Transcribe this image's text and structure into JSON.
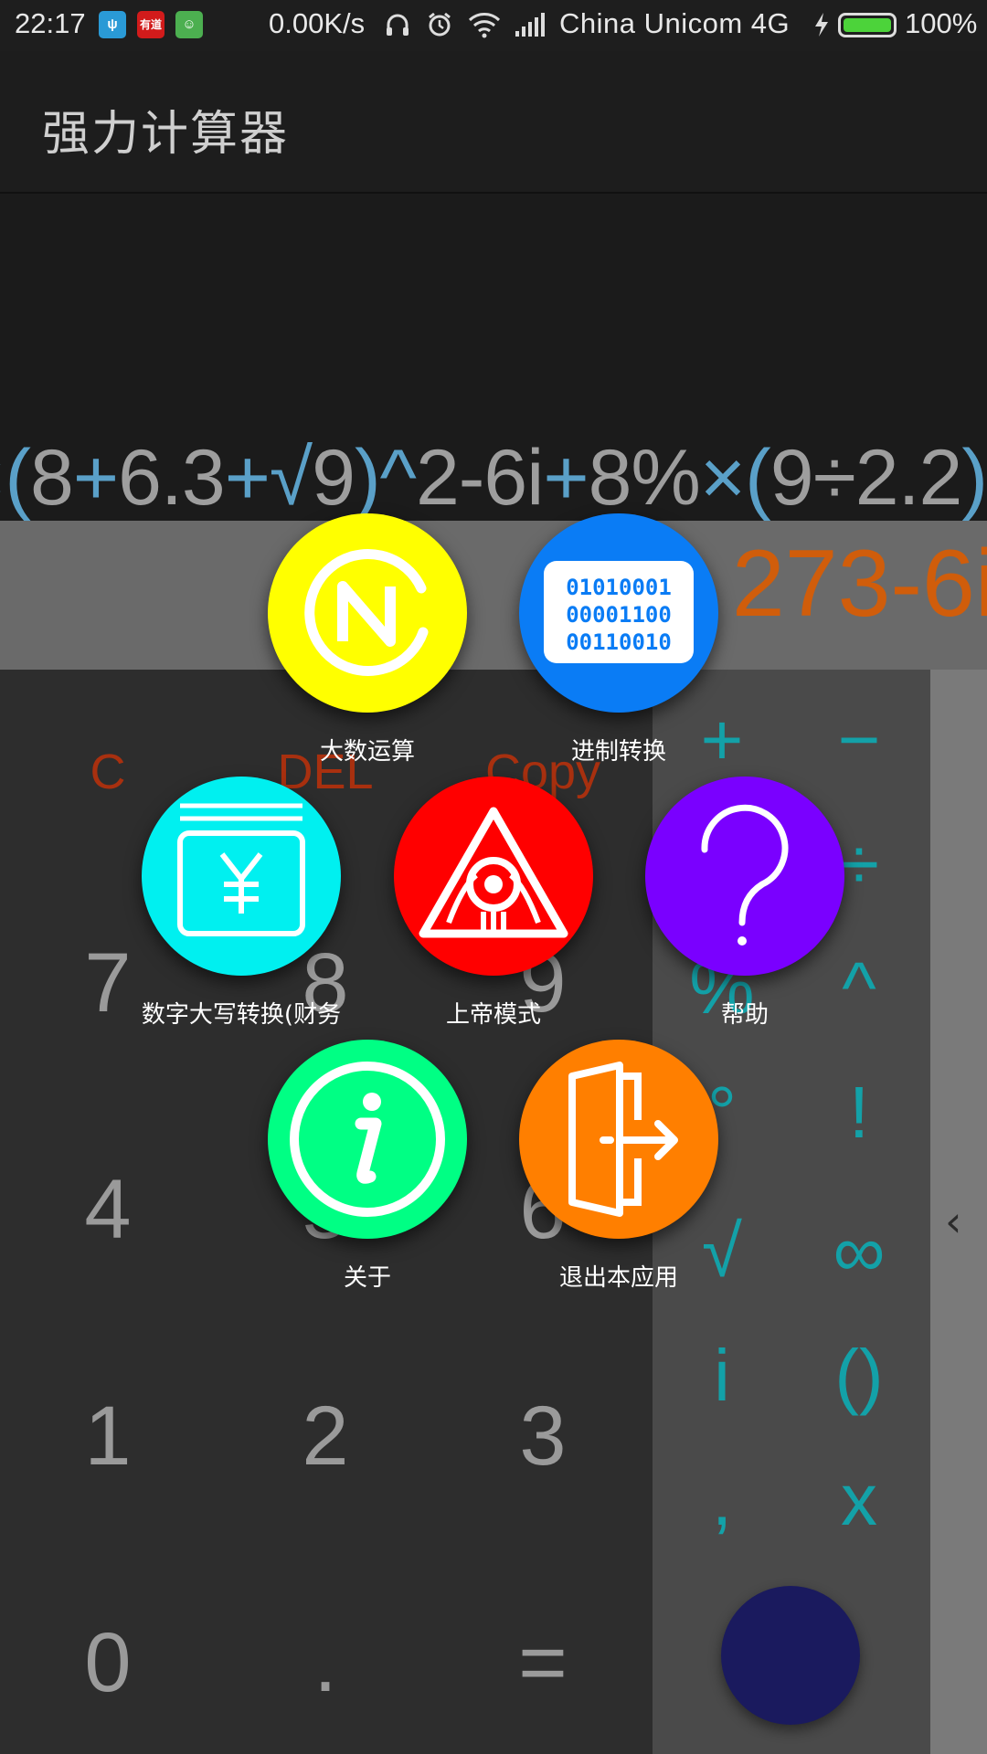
{
  "status_bar": {
    "time": "22:17",
    "net_speed": "0.00K/s",
    "carrier": "China  Unicom  4G",
    "battery_pct": "100%",
    "battery_level": 1.0,
    "notif_icons": [
      "usb-icon",
      "youdao-icon",
      "android-icon"
    ],
    "notif_colors": [
      "#2a9ad6",
      "#d21b1b",
      "#4caf50"
    ],
    "notif_glyph_2": "有道"
  },
  "app": {
    "title": "强力计算器"
  },
  "display": {
    "expression_parts": [
      {
        "t": "9",
        "op": false
      },
      {
        "t": "×(",
        "op": true
      },
      {
        "t": "8",
        "op": false
      },
      {
        "t": "+",
        "op": true
      },
      {
        "t": "6.3",
        "op": false
      },
      {
        "t": "+√",
        "op": true
      },
      {
        "t": "9",
        "op": false
      },
      {
        "t": ")^",
        "op": true
      },
      {
        "t": "2-6i",
        "op": false
      },
      {
        "t": "+",
        "op": true
      },
      {
        "t": "8%",
        "op": false
      },
      {
        "t": "×(",
        "op": true
      },
      {
        "t": "9÷2.2",
        "op": false
      },
      {
        "t": ")",
        "op": true
      }
    ],
    "result": "3     273-6i",
    "colors": {
      "number": "#9e9e9e",
      "operator": "#5aa0c8",
      "result": "#d05d0b"
    }
  },
  "keypad": {
    "function_keys": [
      "C",
      "DEL",
      "Copy"
    ],
    "digits": [
      [
        "7",
        "8",
        "9"
      ],
      [
        "4",
        "5",
        "6"
      ],
      [
        "1",
        "2",
        "3"
      ],
      [
        "0",
        ".",
        "="
      ]
    ]
  },
  "operators": [
    [
      "+",
      "−"
    ],
    [
      "×",
      "÷"
    ],
    [
      "%",
      "^"
    ],
    [
      "°",
      "!"
    ],
    [
      "√",
      "∞"
    ],
    [
      "i",
      "()"
    ],
    [
      ",",
      "x"
    ]
  ],
  "fab_color": "#1a1a5e",
  "menu": [
    {
      "label": "大数运算",
      "icon": "big-number-icon",
      "color": "#ffff00"
    },
    {
      "label": "进制转换",
      "icon": "binary-icon",
      "color": "#0a7cf5"
    },
    {
      "label": "数字大写转换(财务",
      "icon": "yuan-icon",
      "color": "#00f0f0"
    },
    {
      "label": "上帝模式",
      "icon": "eye-triangle-icon",
      "color": "#ff0000"
    },
    {
      "label": "帮助",
      "icon": "question-icon",
      "color": "#7a00ff"
    },
    {
      "label": "关于",
      "icon": "info-icon",
      "color": "#00ff84"
    },
    {
      "label": "退出本应用",
      "icon": "exit-door-icon",
      "color": "#ff7f00"
    }
  ],
  "binary_icon_text": [
    "01010001",
    "00001100",
    "00110010"
  ]
}
